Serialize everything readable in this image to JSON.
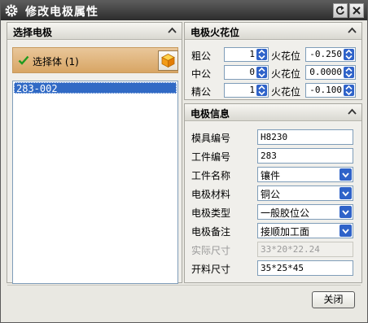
{
  "window": {
    "title": "修改电极属性"
  },
  "left_panel": {
    "title": "选择电极",
    "select_row": {
      "label": "选择体 (1)"
    },
    "list_items": [
      "283-002"
    ]
  },
  "spark_panel": {
    "title": "电极火花位",
    "rows": [
      {
        "label": "粗公",
        "count": "1",
        "spark_label": "火花位",
        "spark_value": "-0.250"
      },
      {
        "label": "中公",
        "count": "0",
        "spark_label": "火花位",
        "spark_value": "0.0000"
      },
      {
        "label": "精公",
        "count": "1",
        "spark_label": "火花位",
        "spark_value": "-0.100"
      }
    ]
  },
  "info_panel": {
    "title": "电极信息",
    "mold_no": {
      "label": "模具编号",
      "value": "H8230"
    },
    "part_no": {
      "label": "工件编号",
      "value": "283"
    },
    "part_name": {
      "label": "工件名称",
      "value": "镶件"
    },
    "material": {
      "label": "电极材料",
      "value": "铜公"
    },
    "type": {
      "label": "电极类型",
      "value": "一般胶位公"
    },
    "note": {
      "label": "电极备注",
      "value": "接顺加工面"
    },
    "actual_size": {
      "label": "实际尺寸",
      "value": "33*20*22.24"
    },
    "stock_size": {
      "label": "开料尺寸",
      "value": "35*25*45"
    }
  },
  "footer": {
    "close_label": "关闭"
  },
  "colors": {
    "titlebar": "#3a3a3a",
    "selection": "#316ac5",
    "select_row": "#d8a564",
    "combo_arrow": "#2f63c9"
  }
}
